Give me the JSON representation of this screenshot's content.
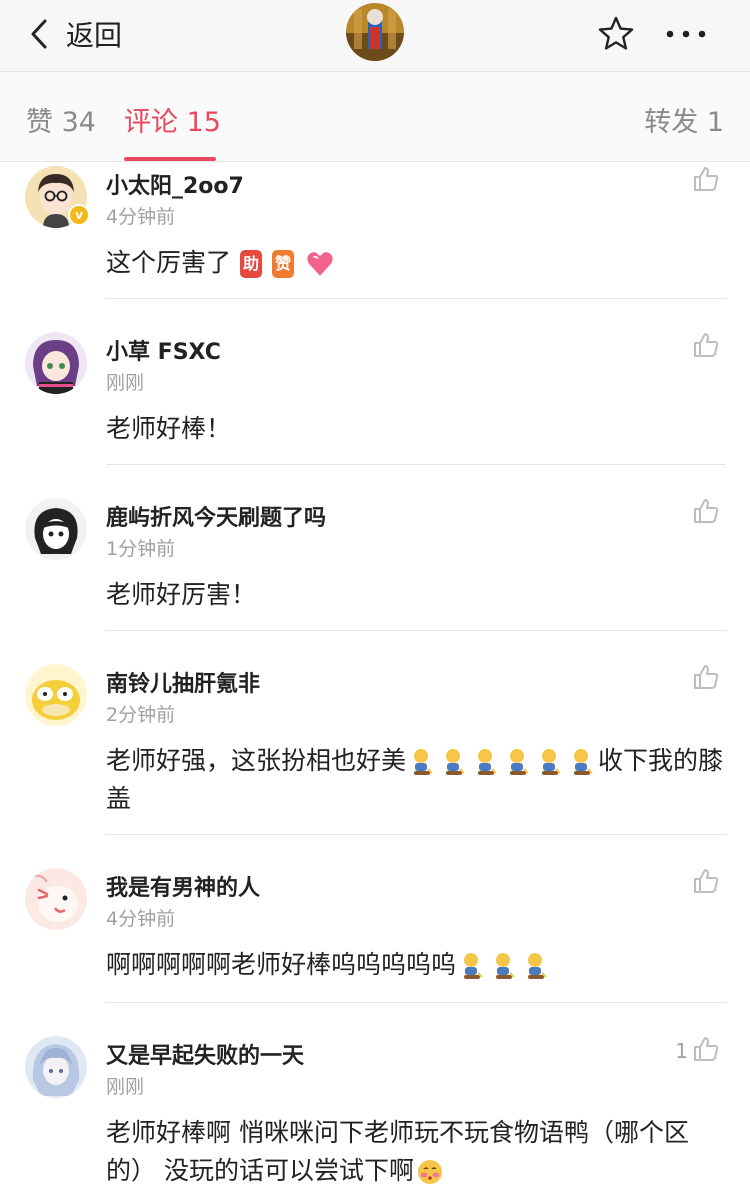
{
  "header": {
    "back_label": "返回"
  },
  "tabs": {
    "likes": "赞 34",
    "comments": "评论 15",
    "reposts": "转发 1"
  },
  "badges": {
    "jiayou": "助",
    "zan": "赞"
  },
  "colors": {
    "accent": "#e8495c",
    "verified": "#f5b917",
    "muted": "#a0a0a0"
  },
  "comments": [
    {
      "username": "小太阳_2oo7",
      "time": "4分钟前",
      "text": "这个厉害了",
      "likes": "",
      "verified": true,
      "verified_mark": "v"
    },
    {
      "username": "小草 FSXC",
      "time": "刚刚",
      "text": "老师好棒！",
      "likes": ""
    },
    {
      "username": "鹿屿折风今天刷题了吗",
      "time": "1分钟前",
      "text": "老师好厉害！",
      "likes": ""
    },
    {
      "username": "南铃儿抽肝氪非",
      "time": "2分钟前",
      "text_a": "老师好强，这张扮相也好美",
      "text_b": "收下我的膝盖",
      "likes": ""
    },
    {
      "username": "我是有男神的人",
      "time": "4分钟前",
      "text": "啊啊啊啊啊老师好棒呜呜呜呜呜",
      "likes": ""
    },
    {
      "username": "又是早起失败的一天",
      "time": "刚刚",
      "text": "老师好棒啊 悄咪咪问下老师玩不玩食物语鸭（哪个区的） 没玩的话可以尝试下啊",
      "likes": "1"
    }
  ]
}
